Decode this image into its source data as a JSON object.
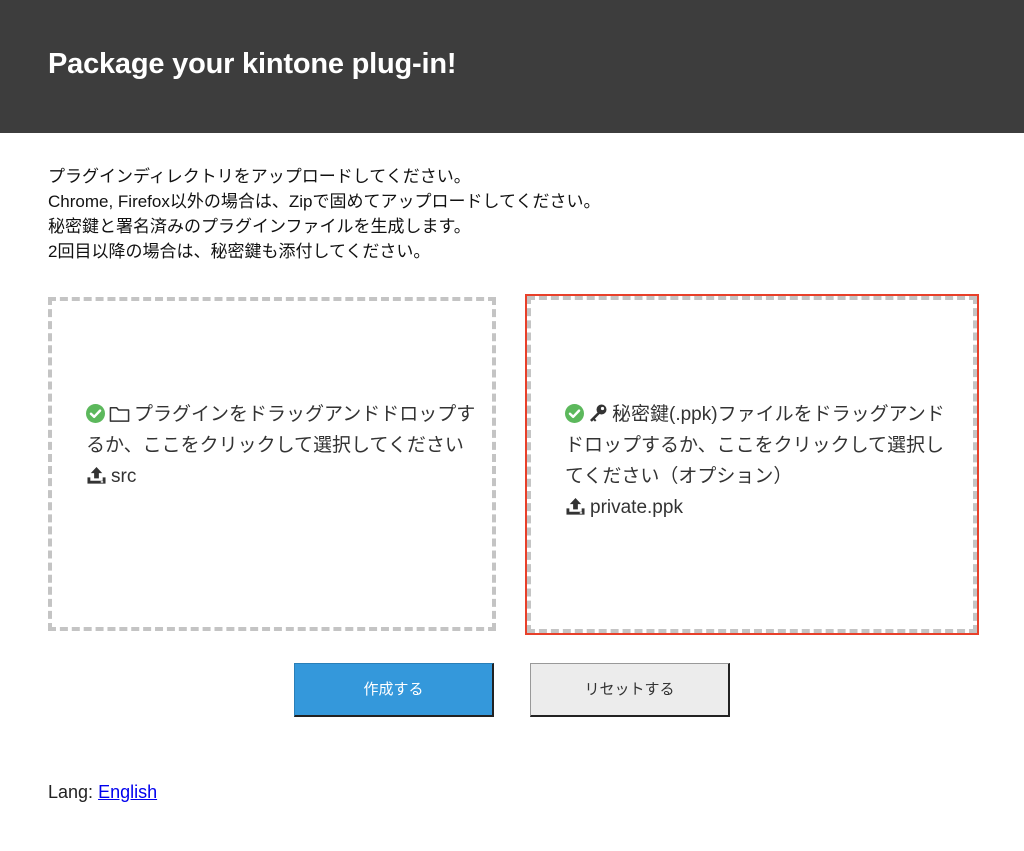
{
  "header": {
    "title": "Package your kintone plug-in!"
  },
  "instructions": [
    "プラグインディレクトリをアップロードしてください。",
    "Chrome, Firefox以外の場合は、Zipで固めてアップロードしてください。",
    "秘密鍵と署名済みのプラグインファイルを生成します。",
    "2回目以降の場合は、秘密鍵も添付してください。"
  ],
  "dropzones": {
    "src": {
      "label": "プラグインをドラッグアンドドロップするか、ここをクリックして選択してください",
      "file_name": "src",
      "icons": [
        "check-circle-icon",
        "folder-icon",
        "upload-icon"
      ]
    },
    "ppk": {
      "label": "秘密鍵(.ppk)ファイルをドラッグアンドドロップするか、ここをクリックして選択してください（オプション）",
      "file_name": "private.ppk",
      "icons": [
        "check-circle-icon",
        "key-icon",
        "upload-icon"
      ]
    }
  },
  "buttons": {
    "create_label": "作成する",
    "reset_label": "リセットする"
  },
  "footer": {
    "lang_label": "Lang:",
    "lang_link": "English"
  },
  "colors": {
    "header_bg": "#3d3d3d",
    "accent_blue": "#3498db",
    "check_green": "#5cb85c",
    "highlight_red": "#e8402a",
    "dashed_border": "#c4c4c4"
  }
}
